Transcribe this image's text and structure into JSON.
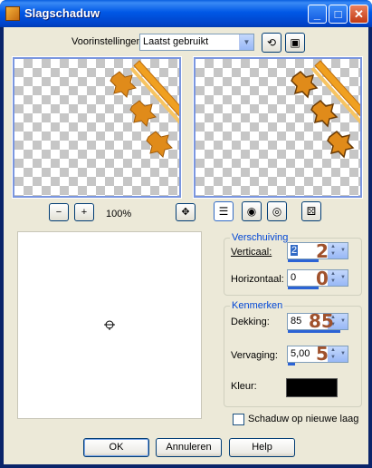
{
  "window": {
    "title": "Slagschaduw"
  },
  "titlebar_buttons": {
    "minimize": "_",
    "maximize": "□",
    "close": "✕"
  },
  "preset": {
    "label": "Voorinstellingen:",
    "value": "Laatst gebruikt"
  },
  "zoom": {
    "level": "100%",
    "zoom_out_glyph": "−",
    "zoom_in_glyph": "+",
    "pan_glyph": "✥"
  },
  "verschuiving": {
    "title": "Verschuiving",
    "vertical": {
      "label": "Verticaal:",
      "value": "2",
      "annotation": "2"
    },
    "horizontal": {
      "label": "Horizontaal:",
      "value": "0",
      "annotation": "0"
    }
  },
  "kenmerken": {
    "title": "Kenmerken",
    "opacity": {
      "label": "Dekking:",
      "value": "85",
      "annotation": "85"
    },
    "blur": {
      "label": "Vervaging:",
      "value": "5,00",
      "annotation": "5"
    },
    "color": {
      "label": "Kleur:",
      "hex": "#000000"
    }
  },
  "new_layer": {
    "label": "Schaduw op nieuwe laag",
    "checked": false
  },
  "buttons": {
    "ok": "OK",
    "cancel": "Annuleren",
    "help": "Help"
  },
  "colors": {
    "accent": "#0046d5",
    "annotation": "#a0522d",
    "ribbon": "#f0a020",
    "leaf": "#e08b1a"
  }
}
